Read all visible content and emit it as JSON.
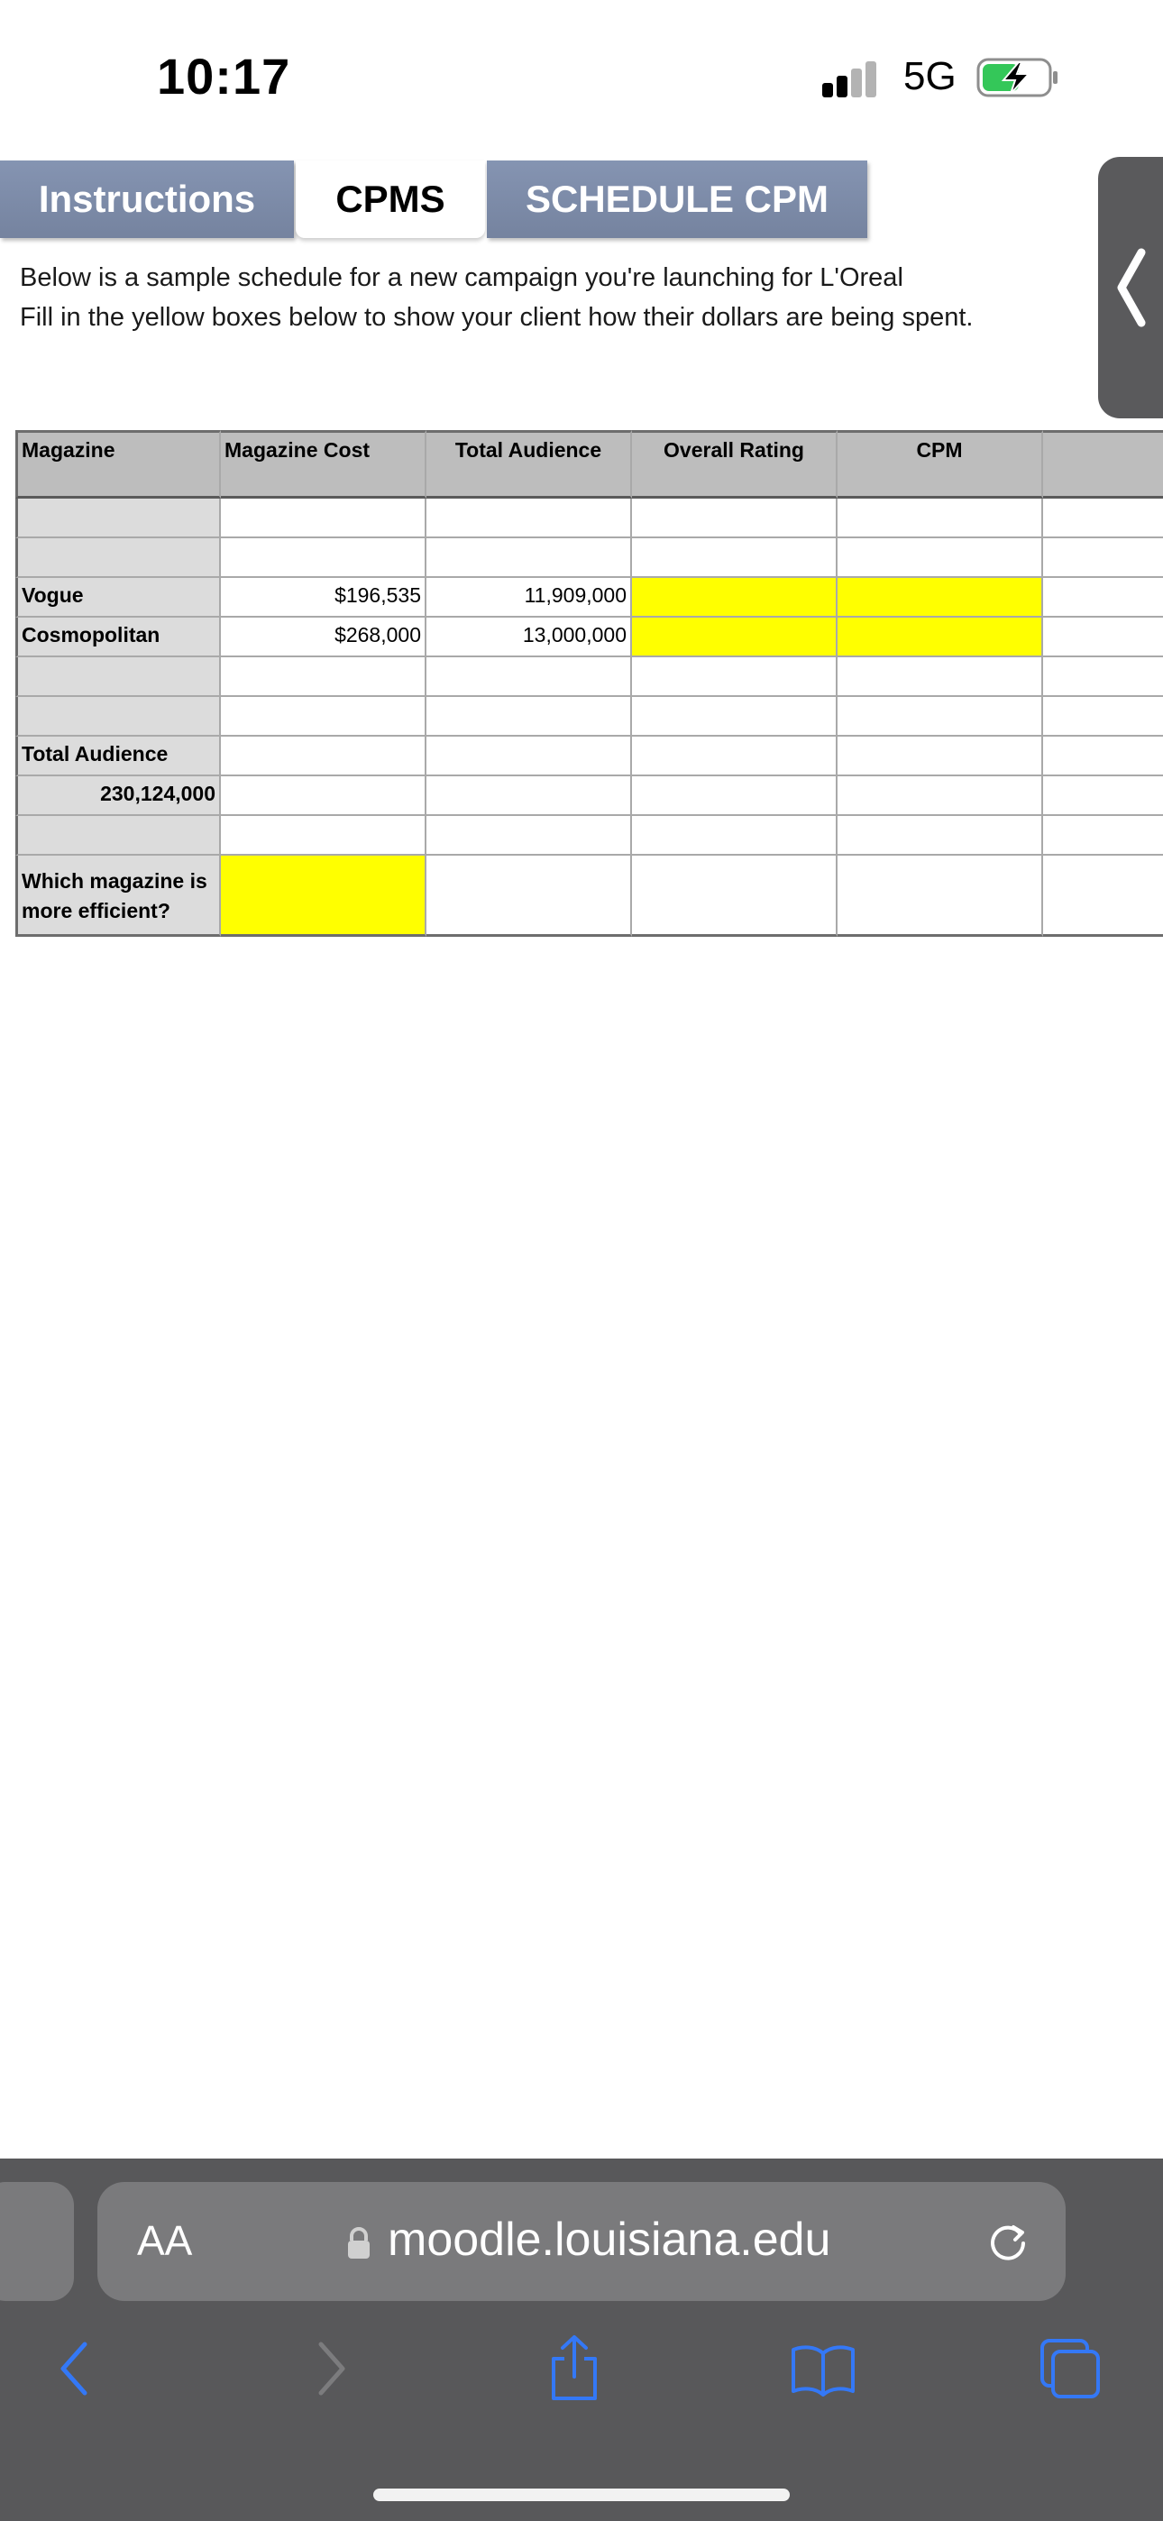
{
  "status_bar": {
    "time": "10:17",
    "network": "5G"
  },
  "tabs": [
    {
      "label": "Instructions"
    },
    {
      "label": "CPMS"
    },
    {
      "label": "SCHEDULE CPM"
    }
  ],
  "intro": {
    "line1": "Below is a sample schedule for a new campaign you're launching for L'Oreal",
    "line2": "Fill in the yellow boxes below to show your client how their dollars are being spent."
  },
  "table": {
    "headers": [
      "Magazine",
      "Magazine Cost",
      "Total Audience",
      "Overall Rating",
      "CPM",
      ""
    ],
    "rows": [
      {
        "name": "Vogue",
        "cost": "$196,535",
        "audience": "11,909,000"
      },
      {
        "name": "Cosmopolitan",
        "cost": "$268,000",
        "audience": "13,000,000"
      }
    ],
    "total_audience_label": "Total Audience",
    "total_audience_value": "230,124,000",
    "question_line1": "Which magazine is",
    "question_line2": "more efficient?"
  },
  "browser": {
    "text_size_label": "AA",
    "url": "moodle.louisiana.edu"
  },
  "colors": {
    "tab_inactive": "#7b89a6",
    "input_yellow": "#ffff00",
    "toolbar": "#58585a",
    "accent_blue": "#3478f6"
  }
}
